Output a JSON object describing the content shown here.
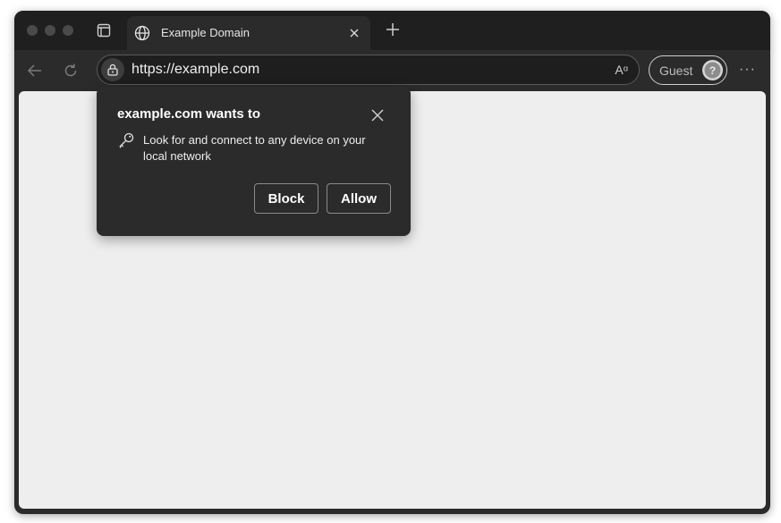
{
  "tab": {
    "title": "Example Domain",
    "favicon_icon": "globe-icon",
    "close_icon": "close-icon"
  },
  "toolbar": {
    "url": "https://example.com",
    "site_info_icon": "lock-icon",
    "read_aloud": "Aᵅ",
    "profile_label": "Guest",
    "more_label": "···"
  },
  "permission_prompt": {
    "title": "example.com wants to",
    "description": "Look for and connect to any device on your local network",
    "block_label": "Block",
    "allow_label": "Allow"
  },
  "colors": {
    "chrome_bg": "#2b2b2b",
    "tabstrip_bg": "#1f1f1f",
    "content_bg": "#eeeeee"
  }
}
